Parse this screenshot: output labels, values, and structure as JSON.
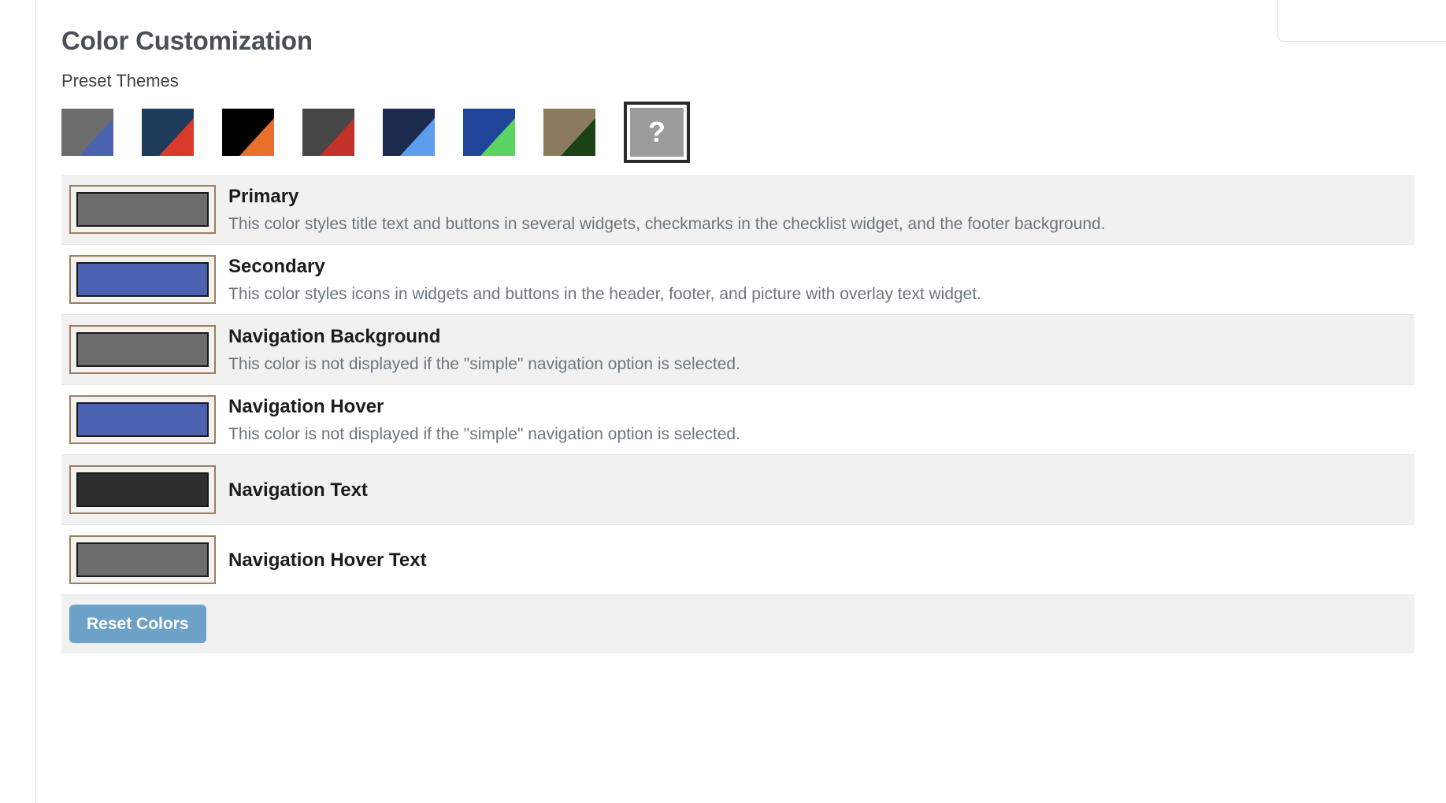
{
  "page": {
    "title": "Color Customization",
    "presets_label": "Preset Themes"
  },
  "presets": {
    "items": [
      {
        "name": "gray-blue-theme",
        "base": "#6d6d6d",
        "accent": "#4a62b0"
      },
      {
        "name": "navy-red-theme",
        "base": "#1d3c5c",
        "accent": "#da3a2c"
      },
      {
        "name": "black-orange-theme",
        "base": "#000000",
        "accent": "#e8702a"
      },
      {
        "name": "charcoal-red-theme",
        "base": "#464646",
        "accent": "#c2312a"
      },
      {
        "name": "midnight-sky-theme",
        "base": "#1b2a4e",
        "accent": "#5c9ded"
      },
      {
        "name": "blue-green-theme",
        "base": "#20449a",
        "accent": "#5cd464"
      },
      {
        "name": "tan-forest-theme",
        "base": "#8c7a5e",
        "accent": "#1c4318"
      }
    ],
    "unknown": {
      "name": "custom-unknown-theme",
      "glyph": "?",
      "base": "#9c9c9c",
      "selected": true
    }
  },
  "color_rows": [
    {
      "title": "Primary",
      "description": "This color styles title text and buttons in several widgets, checkmarks in the checklist widget, and the footer background.",
      "value": "#6d6d6d"
    },
    {
      "title": "Secondary",
      "description": "This color styles icons in widgets and buttons in the header, footer, and picture with overlay text widget.",
      "value": "#4a62b0"
    },
    {
      "title": "Navigation Background",
      "description": "This color is not displayed if the \"simple\" navigation option is selected.",
      "value": "#6d6d6d"
    },
    {
      "title": "Navigation Hover",
      "description": "This color is not displayed if the \"simple\" navigation option is selected.",
      "value": "#4a62b0"
    },
    {
      "title": "Navigation Text",
      "description": "",
      "value": "#2e2e2e"
    },
    {
      "title": "Navigation Hover Text",
      "description": "",
      "value": "#6d6d6d"
    }
  ],
  "reset": {
    "label": "Reset Colors",
    "color": "#6da2c8"
  }
}
